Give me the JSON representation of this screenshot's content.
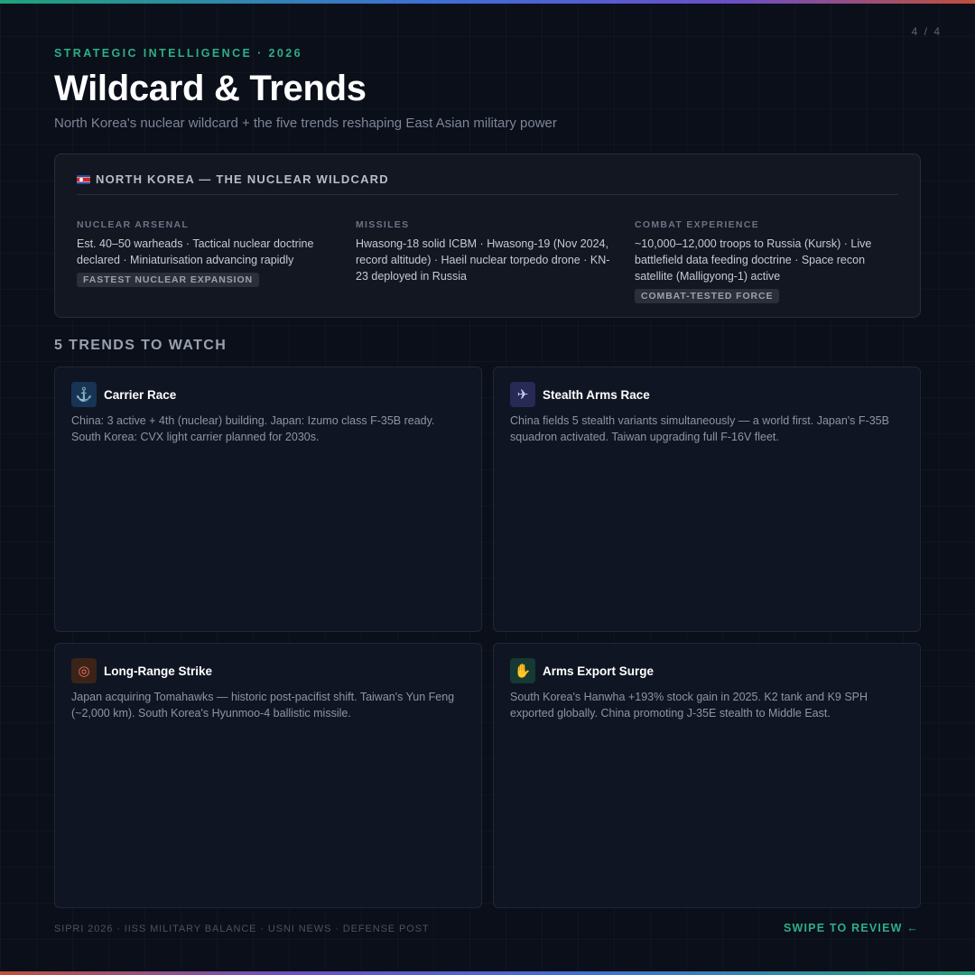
{
  "page": {
    "counter": "4 / 4"
  },
  "header": {
    "eyebrow": "STRATEGIC INTELLIGENCE · 2026",
    "title": "Wildcard & Trends",
    "subtitle": "North Korea's nuclear wildcard + the five trends reshaping East Asian military power"
  },
  "north_korea": {
    "flag_icon": "north-korea-flag-icon",
    "title": "NORTH KOREA — THE NUCLEAR WILDCARD",
    "columns": [
      {
        "label": "NUCLEAR ARSENAL",
        "text": "Est. 40–50 warheads · Tactical nuclear doctrine declared · Miniaturisation advancing rapidly",
        "tag": "FASTEST NUCLEAR EXPANSION"
      },
      {
        "label": "MISSILES",
        "text": "Hwasong-18 solid ICBM · Hwasong-19 (Nov 2024, record altitude) · Haeil nuclear torpedo drone · KN-23 deployed in Russia",
        "tag": ""
      },
      {
        "label": "COMBAT EXPERIENCE",
        "text": "~10,000–12,000 troops to Russia (Kursk) · Live battlefield data feeding doctrine · Space recon satellite (Malligyong-1) active",
        "tag": "COMBAT-TESTED FORCE"
      }
    ]
  },
  "trends": {
    "title": "5 TRENDS TO WATCH",
    "cards": [
      {
        "icon": "⚓",
        "icon_name": "anchor-icon",
        "title": "Carrier Race",
        "text": "China: 3 active + 4th (nuclear) building. Japan: Izumo class F-35B ready. South Korea: CVX light carrier planned for 2030s."
      },
      {
        "icon": "✈",
        "icon_name": "jet-icon",
        "title": "Stealth Arms Race",
        "text": "China fields 5 stealth variants simultaneously — a world first. Japan's F-35B squadron activated. Taiwan upgrading full F-16V fleet."
      },
      {
        "icon": "◎",
        "icon_name": "target-icon",
        "title": "Long-Range Strike",
        "text": "Japan acquiring Tomahawks — historic post-pacifist shift. Taiwan's Yun Feng (~2,000 km). South Korea's Hyunmoo-4 ballistic missile."
      },
      {
        "icon": "✋",
        "icon_name": "handshake-icon",
        "title": "Arms Export Surge",
        "text": "South Korea's Hanwha +193% stock gain in 2025. K2 tank and K9 SPH exported globally. China promoting J-35E stealth to Middle East."
      }
    ]
  },
  "footer": {
    "sources": "SIPRI 2026 · IISS MILITARY BALANCE · USNI NEWS · DEFENSE POST",
    "cta": "SWIPE TO REVIEW ←"
  },
  "colors": {
    "background": "#0a0f1a",
    "accent": "#2fae86",
    "panel": "#121722",
    "card": "#0f1522"
  }
}
